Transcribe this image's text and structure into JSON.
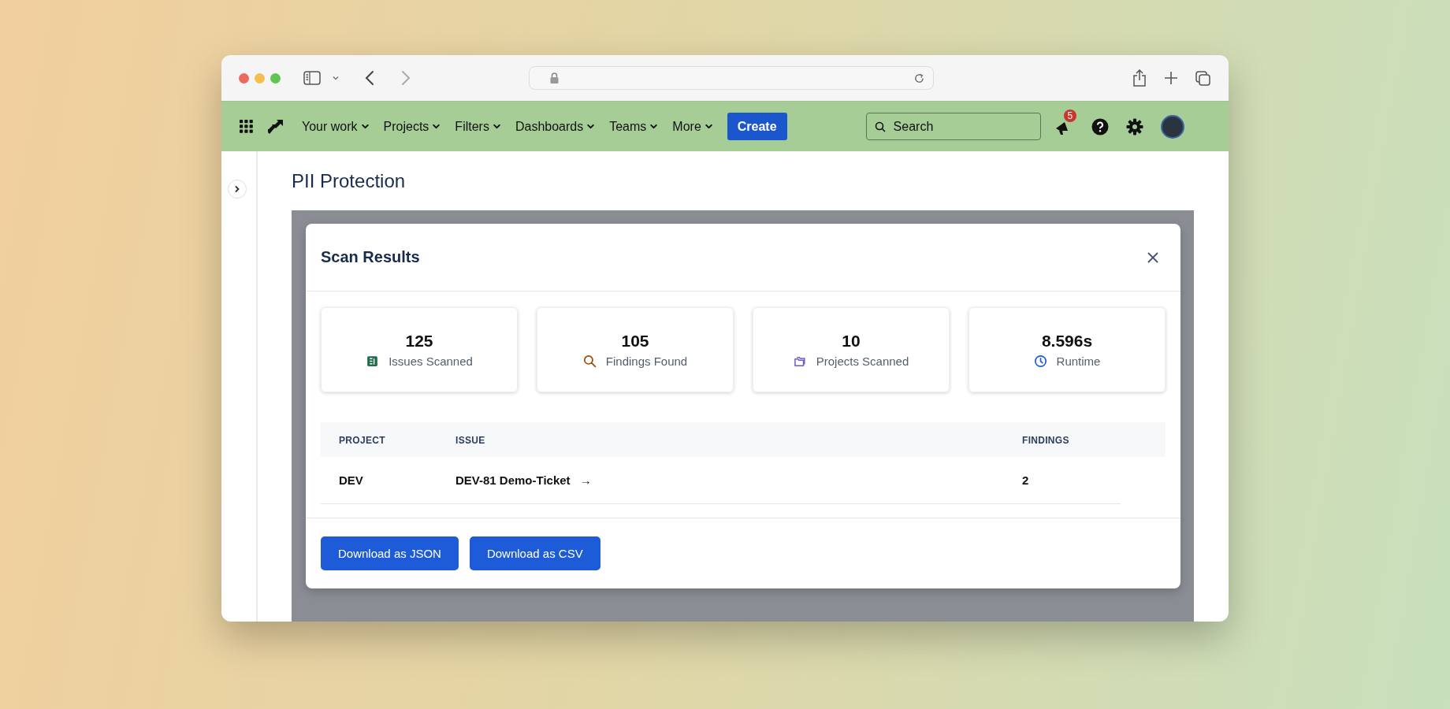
{
  "nav": {
    "items": [
      {
        "label": "Your work"
      },
      {
        "label": "Projects"
      },
      {
        "label": "Filters"
      },
      {
        "label": "Dashboards"
      },
      {
        "label": "Teams"
      },
      {
        "label": "More"
      }
    ],
    "create": "Create",
    "search": {
      "placeholder": "Search"
    },
    "notifications": "5"
  },
  "page": {
    "title": "PII Protection"
  },
  "modal": {
    "title": "Scan Results",
    "stats": [
      {
        "kind": "issues",
        "value": "125",
        "label": "Issues Scanned"
      },
      {
        "kind": "findings",
        "value": "105",
        "label": "Findings Found"
      },
      {
        "kind": "projects",
        "value": "10",
        "label": "Projects Scanned"
      },
      {
        "kind": "runtime",
        "value": "8.596s",
        "label": "Runtime"
      }
    ],
    "table": {
      "columns": [
        "PROJECT",
        "ISSUE",
        "FINDINGS"
      ],
      "rows": [
        {
          "project": "DEV",
          "issue": "DEV-81 Demo-Ticket",
          "arrow": "→",
          "findings": "2"
        }
      ]
    },
    "buttons": [
      "Download as JSON",
      "Download as CSV"
    ]
  }
}
